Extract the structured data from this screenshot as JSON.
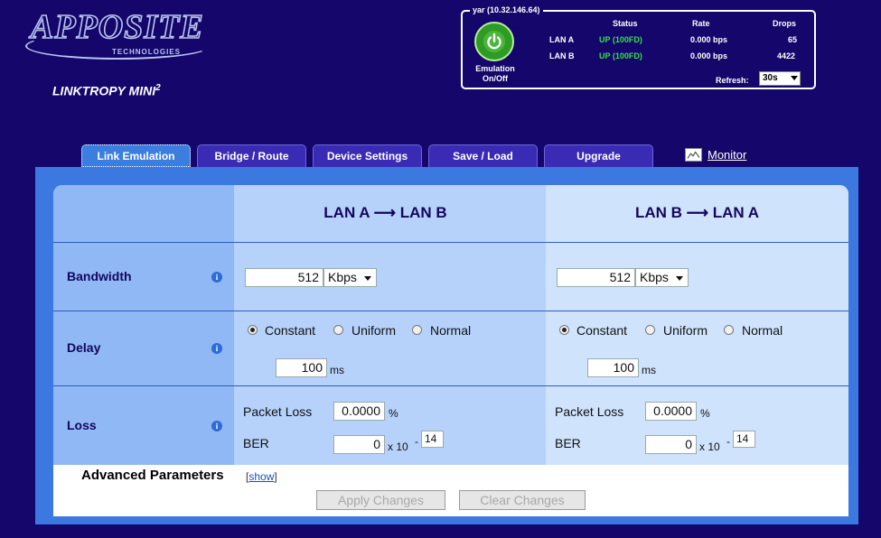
{
  "header": {
    "logo_main": "APPOSITE",
    "logo_sub": "TECHNOLOGIES",
    "product_name": "LINKTROPY MINI",
    "product_sup": "2"
  },
  "status": {
    "device": "yar (10.32.146.64)",
    "emulation_label_1": "Emulation",
    "emulation_label_2": "On/Off",
    "col_status": "Status",
    "col_rate": "Rate",
    "col_drops": "Drops",
    "rows": [
      {
        "name": "LAN A",
        "status": "UP (100FD)",
        "rate": "0.000 bps",
        "drops": "65"
      },
      {
        "name": "LAN B",
        "status": "UP (100FD)",
        "rate": "0.000 bps",
        "drops": "4422"
      }
    ],
    "refresh_label": "Refresh:",
    "refresh_value": "30s"
  },
  "tabs": [
    "Link Emulation",
    "Bridge / Route",
    "Device Settings",
    "Save / Load",
    "Upgrade"
  ],
  "monitor_label": "Monitor",
  "columns": {
    "a_head": "LAN A ⟶ LAN B",
    "b_head": "LAN B ⟶ LAN A"
  },
  "rows": {
    "bandwidth": "Bandwidth",
    "delay": "Delay",
    "loss": "Loss",
    "info": "i"
  },
  "lan_a": {
    "bandwidth_value": "512",
    "bandwidth_unit": "Kbps",
    "delay_options": [
      "Constant",
      "Uniform",
      "Normal"
    ],
    "delay_value": "100",
    "delay_unit": "ms",
    "packet_loss_label": "Packet Loss",
    "packet_loss_value": "0.0000",
    "packet_loss_unit": "%",
    "ber_label": "BER",
    "ber_value": "0",
    "ber_mult": "x 10",
    "ber_dash": "-",
    "ber_exp": "14"
  },
  "lan_b": {
    "bandwidth_value": "512",
    "bandwidth_unit": "Kbps",
    "delay_options": [
      "Constant",
      "Uniform",
      "Normal"
    ],
    "delay_value": "100",
    "delay_unit": "ms",
    "packet_loss_label": "Packet Loss",
    "packet_loss_value": "0.0000",
    "packet_loss_unit": "%",
    "ber_label": "BER",
    "ber_value": "0",
    "ber_mult": "x 10",
    "ber_dash": "-",
    "ber_exp": "14"
  },
  "advanced": {
    "title": "Advanced Parameters",
    "bracket_open": "[",
    "show": "show",
    "bracket_close": "]"
  },
  "buttons": {
    "apply": "Apply Changes",
    "clear": "Clear Changes"
  },
  "colors": {
    "background": "#14066a",
    "panel": "#3b79e0",
    "status_up": "#37e04a",
    "power": "#2e9b24"
  }
}
